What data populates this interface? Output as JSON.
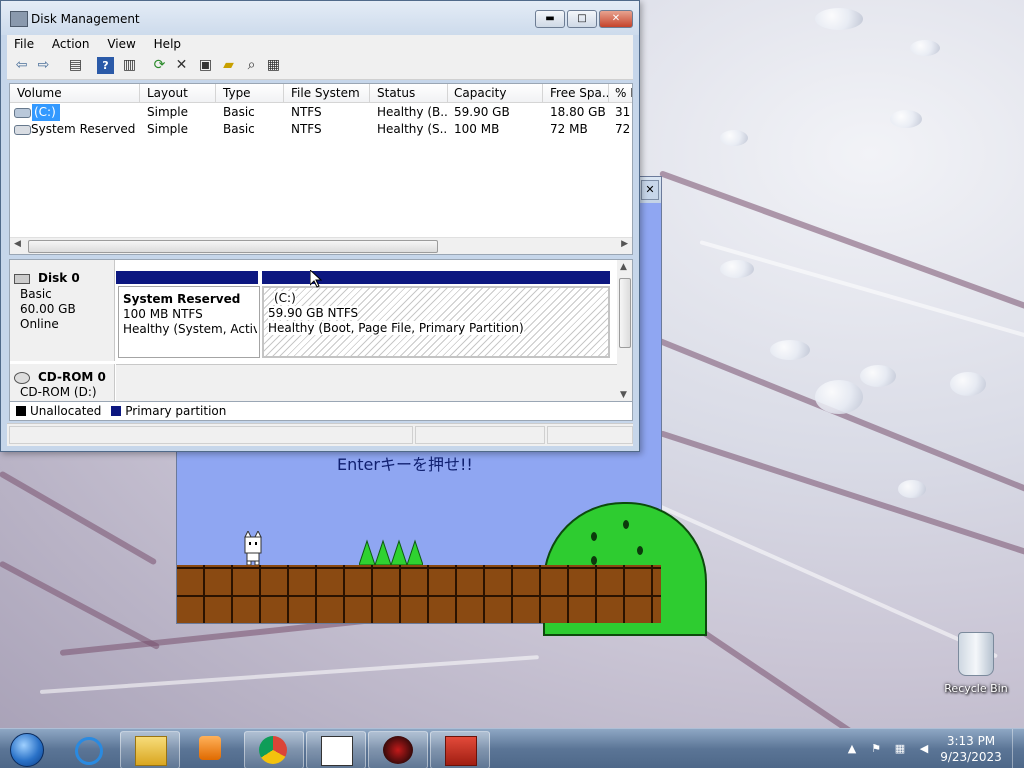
{
  "desktop": {
    "recycle_bin": {
      "label": "Recycle Bin",
      "icon": "recycle-bin-icon"
    }
  },
  "game_window": {
    "prompt": "Enterキーを押せ!!",
    "close_glyph": "✕"
  },
  "disk_management": {
    "title": "Disk Management",
    "caption_buttons": {
      "minimize": "▬",
      "maximize": "□",
      "close": "✕"
    },
    "menu": [
      "File",
      "Action",
      "View",
      "Help"
    ],
    "toolbar_icons": [
      "back-arrow-icon",
      "forward-arrow-icon",
      "show-hide-console-tree-icon",
      "help-icon",
      "show-hide-action-pane-icon",
      "refresh-icon",
      "delete-icon",
      "properties-icon",
      "open-folder-icon",
      "search-icon",
      "settings-icon"
    ],
    "volume_table": {
      "columns": [
        "Volume",
        "Layout",
        "Type",
        "File System",
        "Status",
        "Capacity",
        "Free Spa...",
        "% F"
      ],
      "rows": [
        {
          "volume": "(C:)",
          "layout": "Simple",
          "type": "Basic",
          "fs": "NTFS",
          "status": "Healthy (B...",
          "capacity": "59.90 GB",
          "free": "18.80 GB",
          "pct": "31"
        },
        {
          "volume": "System Reserved",
          "layout": "Simple",
          "type": "Basic",
          "fs": "NTFS",
          "status": "Healthy (S...",
          "capacity": "100 MB",
          "free": "72 MB",
          "pct": "72"
        }
      ]
    },
    "disks": [
      {
        "name": "Disk 0",
        "type": "Basic",
        "size": "60.00 GB",
        "state": "Online",
        "partitions": [
          {
            "name": "System Reserved",
            "size_fs": "100 MB NTFS",
            "status": "Healthy (System, Active,"
          },
          {
            "name": "(C:)",
            "size_fs": "59.90 GB NTFS",
            "status": "Healthy (Boot, Page File, Primary Partition)"
          }
        ]
      },
      {
        "name": "CD-ROM 0",
        "drive": "CD-ROM (D:)"
      }
    ],
    "legend": [
      {
        "label": "Unallocated",
        "color": "#000000"
      },
      {
        "label": "Primary partition",
        "color": "#0c1780"
      }
    ]
  },
  "taskbar": {
    "clock": {
      "time": "3:13 PM",
      "date": "9/23/2023"
    },
    "pinned": [
      "internet-explorer-icon",
      "windows-explorer-icon",
      "media-player-icon",
      "chrome-icon",
      "syobon-cat-icon",
      "bomb-game-icon",
      "computer-management-icon"
    ],
    "tray_icons": [
      "show-hidden-icons-arrow",
      "action-center-icon",
      "network-icon",
      "volume-muted-icon"
    ]
  }
}
